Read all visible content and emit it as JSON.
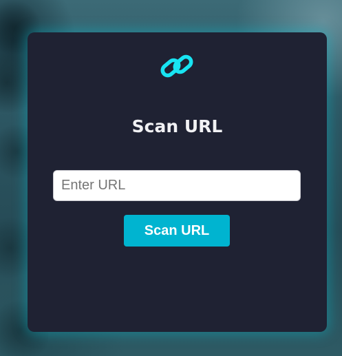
{
  "background": {
    "theme": "misty-forest"
  },
  "card": {
    "icon": "link-icon",
    "title": "Scan URL",
    "url_input": {
      "placeholder": "Enter URL",
      "value": ""
    },
    "scan_button_label": "Scan URL"
  },
  "colors": {
    "accent": "#00b4d0",
    "icon": "#18e4f2",
    "card_background": "#1f2233",
    "title_text": "#f1f1f4"
  }
}
